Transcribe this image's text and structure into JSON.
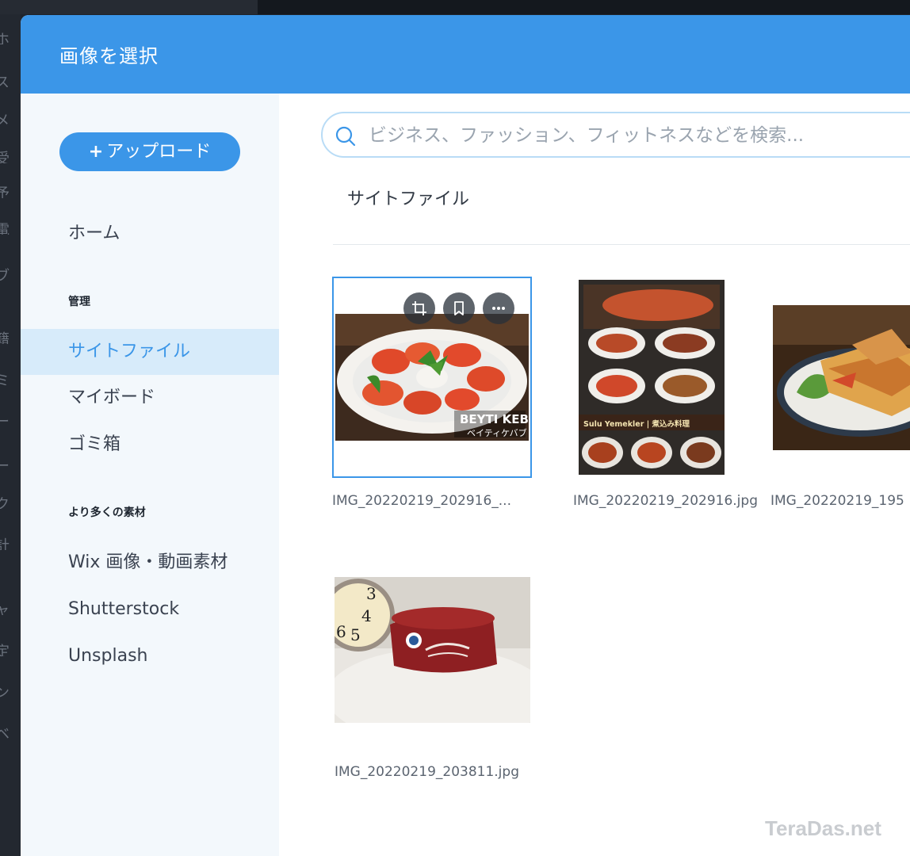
{
  "modal": {
    "title": "画像を選択"
  },
  "sidebar": {
    "upload_plus": "+",
    "upload_label": "アップロード",
    "home": "ホーム",
    "section_manage": "管理",
    "site_files": "サイトファイル",
    "my_boards": "マイボード",
    "trash": "ゴミ箱",
    "section_more": "より多くの素材",
    "wix_media": "Wix 画像・動画素材",
    "shutterstock": "Shutterstock",
    "unsplash": "Unsplash"
  },
  "search": {
    "placeholder": "ビジネス、ファッション、フィットネスなどを検索..."
  },
  "main": {
    "section_title": "サイトファイル",
    "files": [
      {
        "name": "IMG_20220219_202916_...",
        "overlay_text_1": "BEYTI KEBABI",
        "overlay_text_2": "ベイティケバブ"
      },
      {
        "name": "IMG_20220219_202916.jpg",
        "overlay_text_1": "Sulu Yemekler | 煮込み料理"
      },
      {
        "name": "IMG_20220219_195"
      },
      {
        "name": "IMG_20220219_203811.jpg"
      }
    ]
  },
  "colors": {
    "accent": "#3b96e8",
    "active_bg": "#d7ebfa"
  },
  "background": {
    "left_strip_chars": [
      "ホ",
      "ス",
      "メ",
      "受",
      "予",
      "電",
      "ブ",
      "籍",
      "ミ",
      "ー",
      "ー",
      "ク",
      "計",
      "ャ",
      "定",
      "ン",
      "ベ"
    ]
  },
  "watermark": "TeraDas.net"
}
